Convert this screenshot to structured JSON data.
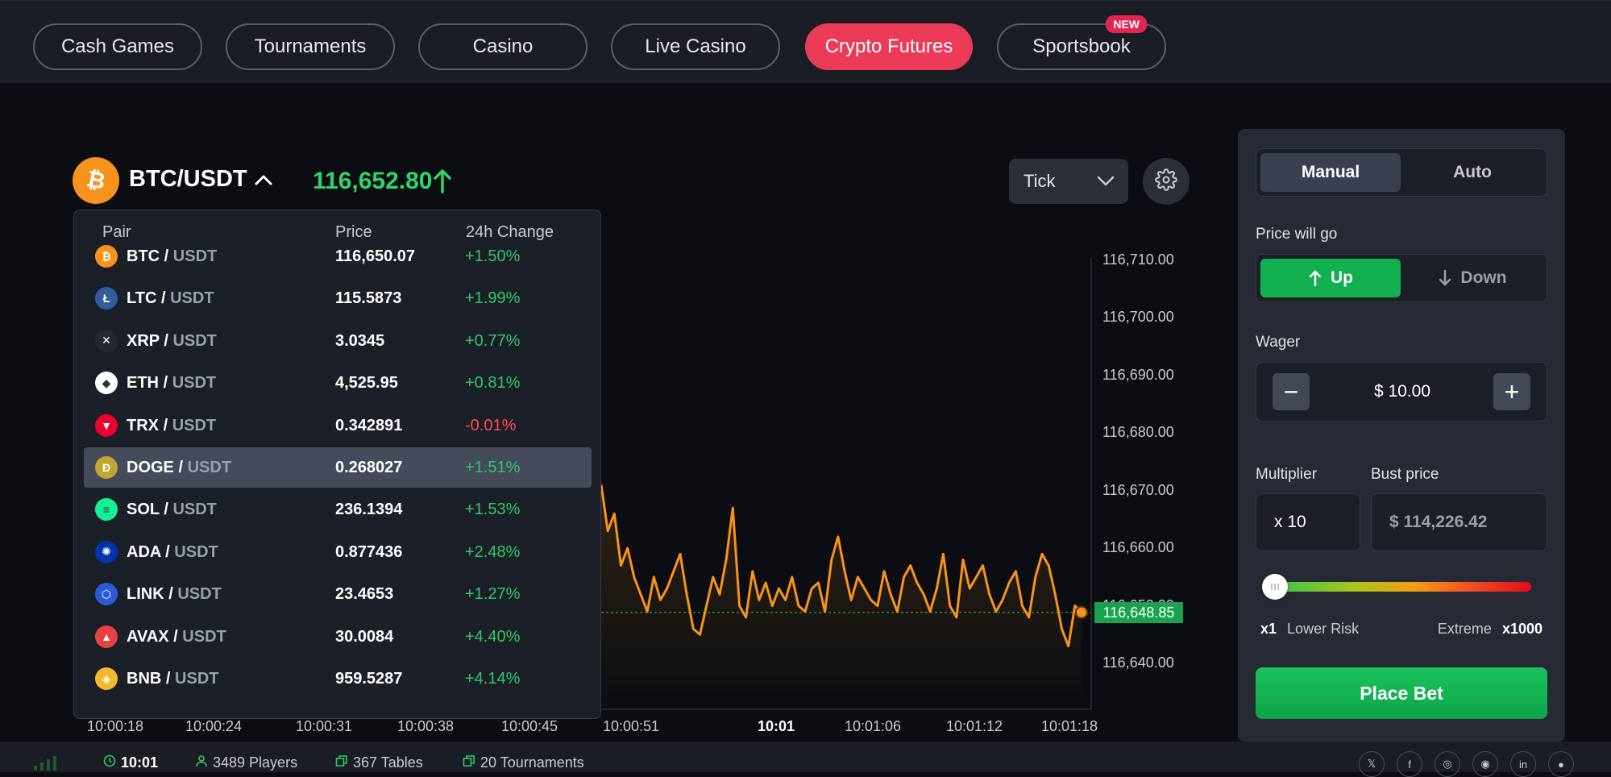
{
  "nav": {
    "tabs": [
      {
        "label": "Cash Games",
        "active": false
      },
      {
        "label": "Tournaments",
        "active": false
      },
      {
        "label": "Casino",
        "active": false
      },
      {
        "label": "Live Casino",
        "active": false
      },
      {
        "label": "Crypto Futures",
        "active": true
      },
      {
        "label": "Sportsbook",
        "active": false,
        "badge": "NEW"
      }
    ]
  },
  "pair_header": {
    "title": "BTC/USDT",
    "price": "116,652.80",
    "direction_icon": "arrow-up-icon",
    "coin_icon": "bitcoin-icon"
  },
  "chart_controls": {
    "type_select": "Tick",
    "settings_icon": "gear-icon"
  },
  "pair_dropdown": {
    "headers": {
      "pair": "Pair",
      "price": "Price",
      "change": "24h Change"
    },
    "quote_separator": "/",
    "rows": [
      {
        "base": "BTC",
        "quote": "USDT",
        "price": "116,650.07",
        "change": "+1.50%",
        "positive": true,
        "highlighted": false,
        "icon": "bitcoin-icon",
        "color": "#f7931a"
      },
      {
        "base": "LTC",
        "quote": "USDT",
        "price": "115.5873",
        "change": "+1.99%",
        "positive": true,
        "highlighted": false,
        "icon": "litecoin-icon",
        "color": "#345d9d"
      },
      {
        "base": "XRP",
        "quote": "USDT",
        "price": "3.0345",
        "change": "+0.77%",
        "positive": true,
        "highlighted": false,
        "icon": "xrp-icon",
        "color": "#23292f"
      },
      {
        "base": "ETH",
        "quote": "USDT",
        "price": "4,525.95",
        "change": "+0.81%",
        "positive": true,
        "highlighted": false,
        "icon": "ethereum-icon",
        "color": "#ffffff"
      },
      {
        "base": "TRX",
        "quote": "USDT",
        "price": "0.342891",
        "change": "-0.01%",
        "positive": false,
        "highlighted": false,
        "icon": "tron-icon",
        "color": "#eb0029"
      },
      {
        "base": "DOGE",
        "quote": "USDT",
        "price": "0.268027",
        "change": "+1.51%",
        "positive": true,
        "highlighted": true,
        "icon": "dogecoin-icon",
        "color": "#c2a633"
      },
      {
        "base": "SOL",
        "quote": "USDT",
        "price": "236.1394",
        "change": "+1.53%",
        "positive": true,
        "highlighted": false,
        "icon": "solana-icon",
        "color": "#14f195"
      },
      {
        "base": "ADA",
        "quote": "USDT",
        "price": "0.877436",
        "change": "+2.48%",
        "positive": true,
        "highlighted": false,
        "icon": "cardano-icon",
        "color": "#0033ad"
      },
      {
        "base": "LINK",
        "quote": "USDT",
        "price": "23.4653",
        "change": "+1.27%",
        "positive": true,
        "highlighted": false,
        "icon": "chainlink-icon",
        "color": "#2a5ada"
      },
      {
        "base": "AVAX",
        "quote": "USDT",
        "price": "30.0084",
        "change": "+4.40%",
        "positive": true,
        "highlighted": false,
        "icon": "avalanche-icon",
        "color": "#e84142"
      },
      {
        "base": "BNB",
        "quote": "USDT",
        "price": "959.5287",
        "change": "+4.14%",
        "positive": true,
        "highlighted": false,
        "icon": "bnb-icon",
        "color": "#f3ba2f"
      }
    ]
  },
  "chart": {
    "y_ticks": [
      "116,710.00",
      "116,700.00",
      "116,690.00",
      "116,680.00",
      "116,670.00",
      "116,660.00",
      "116,650.00",
      "116,640.00"
    ],
    "x_ticks": [
      "10:00:18",
      "10:00:24",
      "10:00:31",
      "10:00:38",
      "10:00:45",
      "10:00:51",
      "10:01",
      "10:01:06",
      "10:01:12",
      "10:01:18"
    ],
    "current_price_label": "116,648.85",
    "line_color": "#f7931a",
    "series": [
      116671,
      116663,
      116666,
      116657,
      116660,
      116655,
      116652,
      116649,
      116655,
      116651,
      116653,
      116656,
      116659,
      116652,
      116646,
      116645,
      116650,
      116655,
      116652,
      116658,
      116667,
      116650,
      116648,
      116656,
      116651,
      116654,
      116650,
      116653,
      116651,
      116655,
      116650,
      116649,
      116653,
      116654,
      116649,
      116658,
      116662,
      116656,
      116651,
      116655,
      116653,
      116651,
      116650,
      116656,
      116652,
      116649,
      116655,
      116657,
      116654,
      116652,
      116649,
      116653,
      116659,
      116650,
      116648,
      116658,
      116653,
      116655,
      116657,
      116652,
      116649,
      116651,
      116654,
      116656,
      116650,
      116648,
      116655,
      116659,
      116657,
      116652,
      116646,
      116643,
      116650,
      116648.85
    ]
  },
  "bet_panel": {
    "mode_tabs": [
      {
        "label": "Manual",
        "active": true
      },
      {
        "label": "Auto",
        "active": false
      }
    ],
    "direction_label": "Price will go",
    "up_label": "Up",
    "down_label": "Down",
    "wager_label": "Wager",
    "wager_value": "$ 10.00",
    "minus_symbol": "−",
    "plus_symbol": "+",
    "multiplier_label": "Multiplier",
    "multiplier_value": "x 10",
    "bust_label": "Bust price",
    "bust_value": "$ 114,226.42",
    "risk_min_mult": "x1",
    "risk_min_label": "Lower Risk",
    "risk_max_label": "Extreme",
    "risk_max_mult": "x1000",
    "multiplier_level": 0.0,
    "place_bet": "Place Bet"
  },
  "footer": {
    "time": "10:01",
    "players": "3489 Players",
    "tables": "367 Tables",
    "tournaments": "20 Tournaments",
    "socials": [
      "x-icon",
      "facebook-icon",
      "instagram-icon",
      "discord-icon",
      "linkedin-icon",
      "reddit-icon"
    ]
  }
}
